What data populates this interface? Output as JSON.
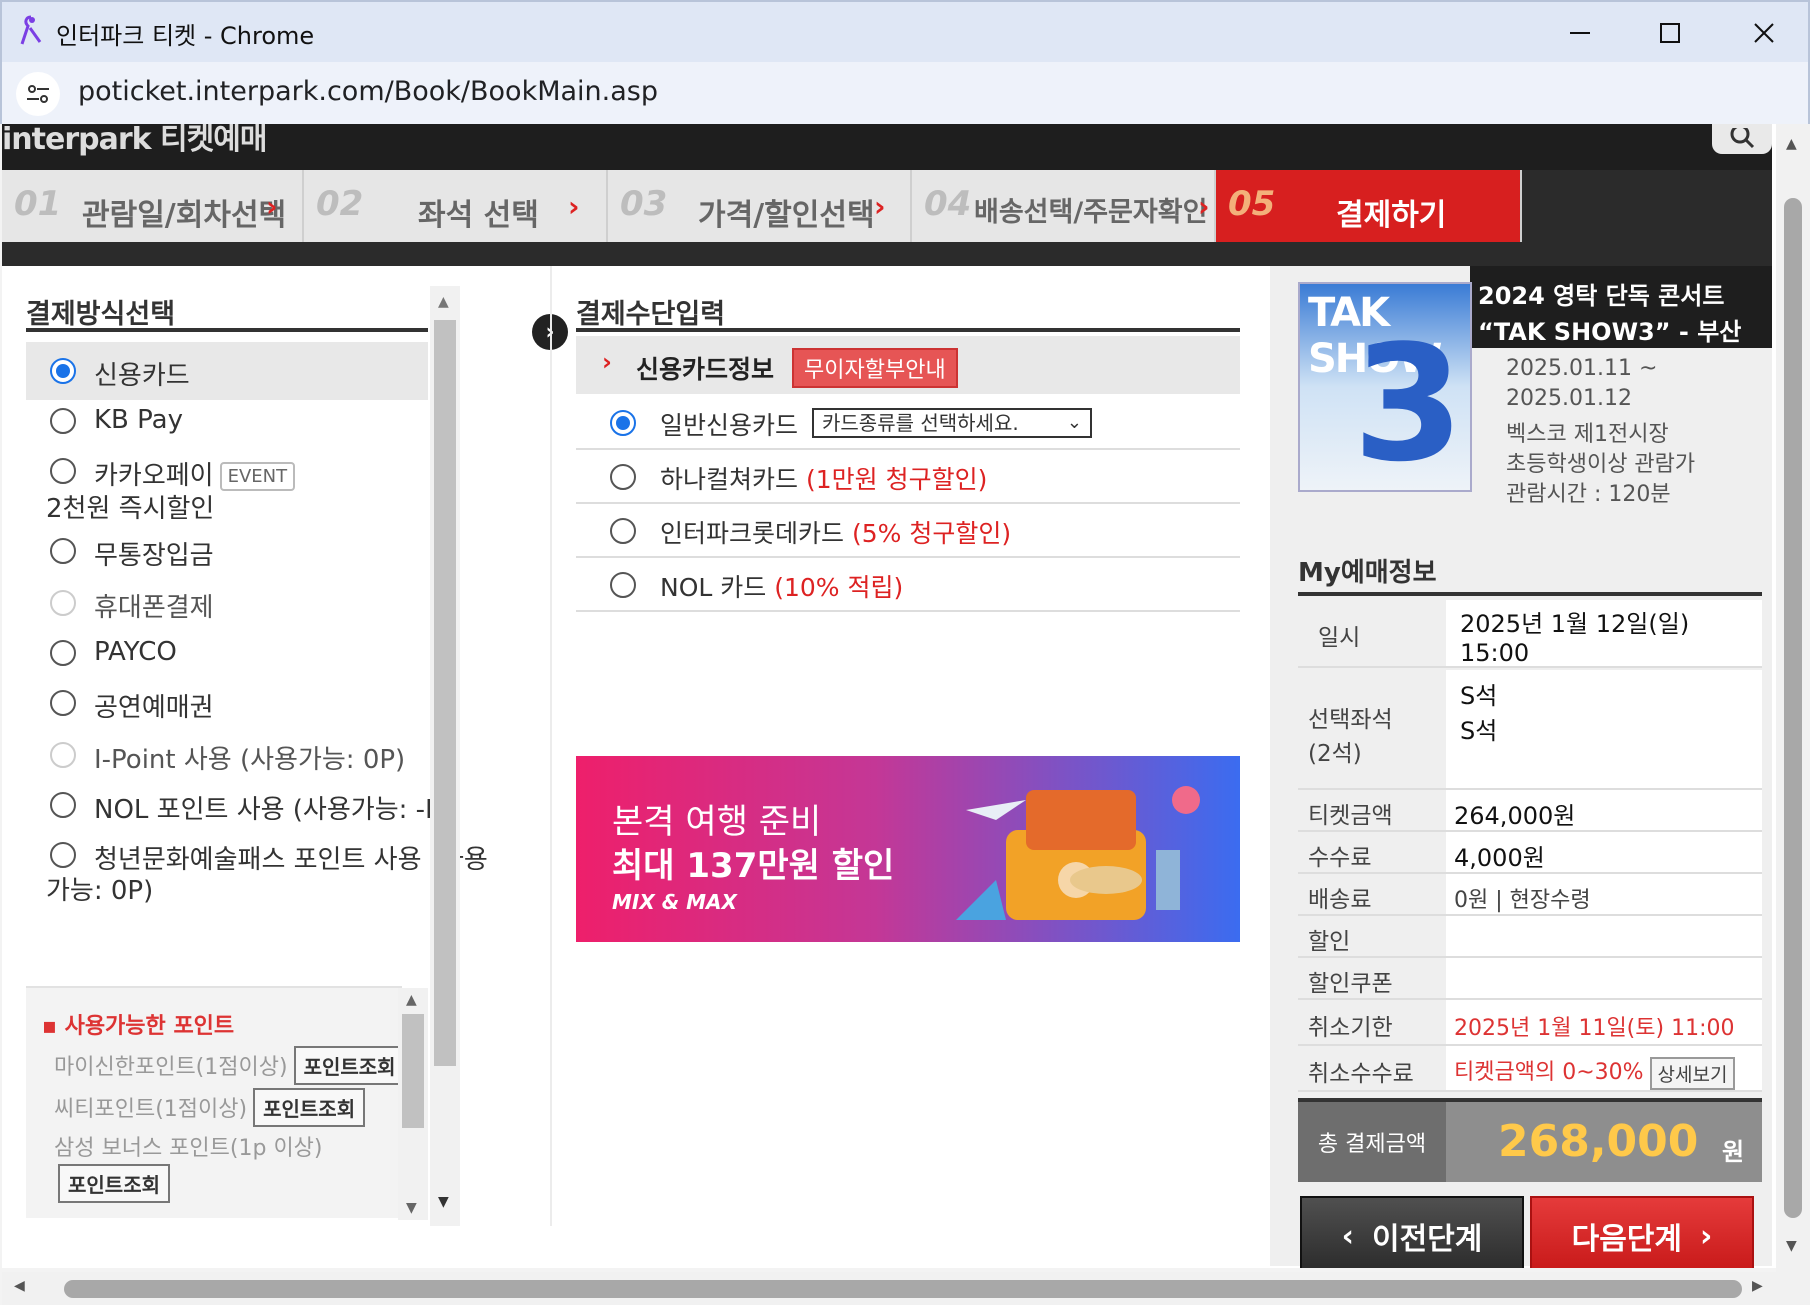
{
  "window": {
    "title": "인터파크 티켓 - Chrome",
    "url": "poticket.interpark.com/Book/BookMain.asp"
  },
  "header": {
    "brand": "interpark 티켓예매",
    "steps": [
      {
        "num": "01",
        "label": "관람일/회차선택"
      },
      {
        "num": "02",
        "label": "좌석 선택"
      },
      {
        "num": "03",
        "label": "가격/할인선택"
      },
      {
        "num": "04",
        "label": "배송선택/주문자확인"
      },
      {
        "num": "05",
        "label": "결제하기"
      }
    ]
  },
  "payment_methods": {
    "title": "결제방식선택",
    "options": [
      {
        "label": "신용카드",
        "selected": true
      },
      {
        "label": "KB Pay"
      },
      {
        "label": "카카오페이",
        "badge": "EVENT",
        "sub": "2천원 즉시할인"
      },
      {
        "label": "무통장입금"
      },
      {
        "label": "휴대폰결제",
        "disabled": true
      },
      {
        "label": "PAYCO"
      },
      {
        "label": "공연예매권"
      },
      {
        "label": "I-Point 사용 (사용가능: 0P)",
        "disabled": true
      },
      {
        "label": "NOL 포인트 사용 (사용가능: -P)"
      },
      {
        "label": "청년문화예술패스 포인트 사용 (사용",
        "sub": "가능: 0P)"
      }
    ],
    "points": {
      "title": "사용가능한 포인트",
      "rows": [
        {
          "label": "마이신한포인트(1점이상)",
          "button": "포인트조회"
        },
        {
          "label": "씨티포인트(1점이상)",
          "button": "포인트조회"
        },
        {
          "label": "삼성 보너스 포인트(1p 이상)",
          "button": "포인트조회"
        }
      ]
    }
  },
  "payment_input": {
    "title": "결제수단입력",
    "card_header": "신용카드정보",
    "installment_badge": "무이자할부안내",
    "rows": [
      {
        "label": "일반신용카드",
        "select": "카드종류를 선택하세요.",
        "selected": true
      },
      {
        "label": "하나컬쳐카드",
        "promo": "(1만원 청구할인)"
      },
      {
        "label": "인터파크롯데카드",
        "promo": "(5% 청구할인)"
      },
      {
        "label": "NOL 카드",
        "promo": "(10% 적립)"
      }
    ],
    "banner": {
      "line1": "본격 여행 준비",
      "line2": "최대 137만원 할인",
      "line3": "MIX & MAX"
    }
  },
  "summary": {
    "poster_text": "TAK SHOW",
    "poster_number": "3",
    "title_line1": "2024 영탁 단독 콘서트",
    "title_line2": "“TAK SHOW3” - 부산",
    "info": [
      "2025.01.11 ~",
      "2025.01.12",
      "벡스코 제1전시장",
      "초등학생이상 관람가",
      "관람시간 : 120분"
    ],
    "my_title": "My예매정보",
    "rows": [
      {
        "key": "일시",
        "value": "2025년 1월 12일(일)",
        "value2": "15:00"
      },
      {
        "key": "선택좌석",
        "key2": "(2석)",
        "value": "S석",
        "value2": "S석"
      },
      {
        "key": "티켓금액",
        "value": "264,000원"
      },
      {
        "key": "수수료",
        "value": "4,000원"
      },
      {
        "key": "배송료",
        "value": "0원 | 현장수령"
      },
      {
        "key": "할인",
        "value": ""
      },
      {
        "key": "할인쿠폰",
        "value": ""
      },
      {
        "key": "취소기한",
        "value": "2025년 1월 11일(토) 11:00"
      },
      {
        "key": "취소수수료",
        "value": "티켓금액의 0~30%",
        "button": "상세보기"
      }
    ],
    "total_label": "총 결제금액",
    "total_amount": "268,000",
    "total_unit": "원",
    "prev_button": "이전단계",
    "next_button": "다음단계"
  },
  "colors": {
    "accent_red": "#d71f1f",
    "radio_blue": "#1a73e8",
    "total_yellow": "#ffc94a"
  }
}
